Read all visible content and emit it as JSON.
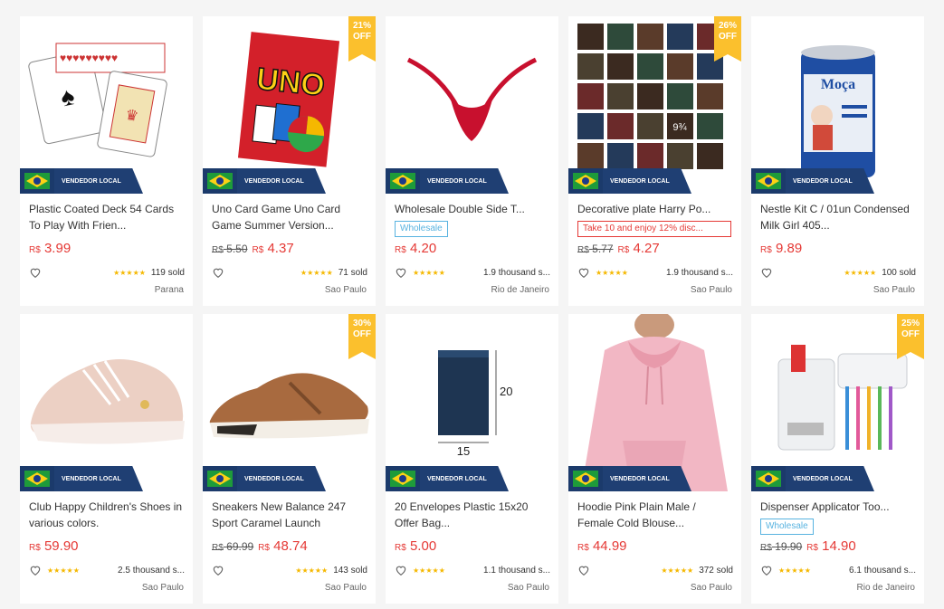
{
  "badge_local": "VENDEDOR LOCAL",
  "products": [
    {
      "title": "Plastic Coated Deck 54 Cards To Play With Frien...",
      "old_price": "",
      "price": "3.99",
      "currency": "R$",
      "rating": "★★★★★",
      "sold": "119 sold",
      "location": "Parana",
      "discount": "",
      "tag": ""
    },
    {
      "title": "Uno Card Game Uno Card Game Summer Version...",
      "old_price": "5.50",
      "price": "4.37",
      "currency": "R$",
      "rating": "★★★★★",
      "sold": "71 sold",
      "location": "Sao Paulo",
      "discount": "21% OFF",
      "tag": ""
    },
    {
      "title": "Wholesale Double Side T...",
      "old_price": "",
      "price": "4.20",
      "currency": "R$",
      "rating": "★★★★★",
      "sold": "1.9 thousand s...",
      "location": "Rio de Janeiro",
      "discount": "",
      "tag": "Wholesale"
    },
    {
      "title": "Decorative plate Harry Po...",
      "old_price": "5.77",
      "price": "4.27",
      "currency": "R$",
      "rating": "★★★★★",
      "sold": "1.9 thousand s...",
      "location": "Sao Paulo",
      "discount": "26% OFF",
      "tag": "Take 10 and enjoy 12% disc..."
    },
    {
      "title": "Nestle Kit C / 01un Condensed Milk Girl 405...",
      "old_price": "",
      "price": "9.89",
      "currency": "R$",
      "rating": "★★★★★",
      "sold": "100 sold",
      "location": "Sao Paulo",
      "discount": "",
      "tag": ""
    },
    {
      "title": "Club Happy Children's Shoes in various colors.",
      "old_price": "",
      "price": "59.90",
      "currency": "R$",
      "rating": "★★★★★",
      "sold": "2.5 thousand s...",
      "location": "Sao Paulo",
      "discount": "",
      "tag": ""
    },
    {
      "title": "Sneakers New Balance 247 Sport Caramel Launch",
      "old_price": "69.99",
      "price": "48.74",
      "currency": "R$",
      "rating": "★★★★★",
      "sold": "143 sold",
      "location": "Sao Paulo",
      "discount": "30% OFF",
      "tag": ""
    },
    {
      "title": "20 Envelopes Plastic 15x20 Offer Bag...",
      "old_price": "",
      "price": "5.00",
      "currency": "R$",
      "rating": "★★★★★",
      "sold": "1.1 thousand s...",
      "location": "Sao Paulo",
      "discount": "",
      "tag": ""
    },
    {
      "title": "Hoodie Pink Plain Male / Female Cold Blouse...",
      "old_price": "",
      "price": "44.99",
      "currency": "R$",
      "rating": "★★★★★",
      "sold": "372 sold",
      "location": "Sao Paulo",
      "discount": "",
      "tag": ""
    },
    {
      "title": "Dispenser Applicator Too...",
      "old_price": "19.90",
      "price": "14.90",
      "currency": "R$",
      "rating": "★★★★★",
      "sold": "6.1 thousand s...",
      "location": "Rio de Janeiro",
      "discount": "25% OFF",
      "tag": "Wholesale"
    }
  ],
  "images": {
    "uno_text": "UNO",
    "milk_text": "Moça",
    "envelope_w": "15",
    "envelope_h": "20",
    "plate_number": "9¾"
  },
  "icons": [
    "heart-icon",
    "brazil-flag-icon",
    "star-icon"
  ],
  "colors": {
    "price": "#e53935",
    "discount_badge": "#fbc02d",
    "local_badge": "#1f3f73",
    "wholesale": "#58b3e0"
  }
}
